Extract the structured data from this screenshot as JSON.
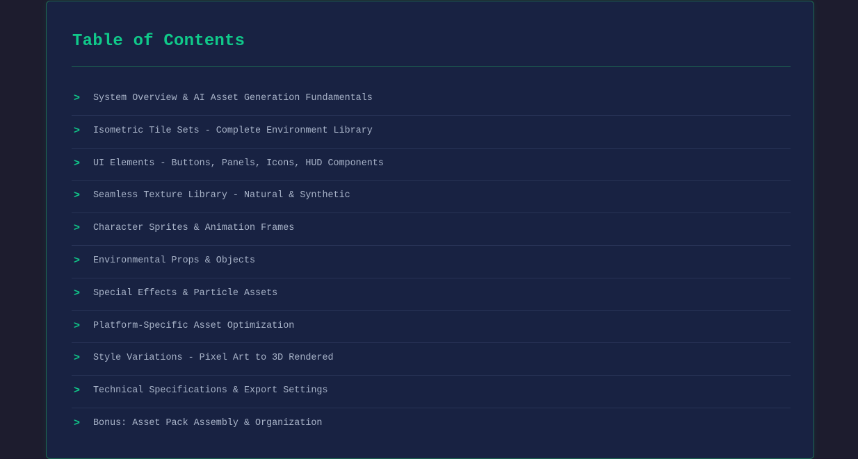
{
  "toc": {
    "title": "Table of Contents",
    "marker": ">",
    "accent_color": "#10c98a",
    "items": [
      {
        "label": "System Overview & AI Asset Generation Fundamentals"
      },
      {
        "label": "Isometric Tile Sets - Complete Environment Library"
      },
      {
        "label": "UI Elements - Buttons, Panels, Icons, HUD Components"
      },
      {
        "label": "Seamless Texture Library - Natural & Synthetic"
      },
      {
        "label": "Character Sprites & Animation Frames"
      },
      {
        "label": "Environmental Props & Objects"
      },
      {
        "label": "Special Effects & Particle Assets"
      },
      {
        "label": "Platform-Specific Asset Optimization"
      },
      {
        "label": "Style Variations - Pixel Art to 3D Rendered"
      },
      {
        "label": "Technical Specifications & Export Settings"
      },
      {
        "label": "Bonus: Asset Pack Assembly & Organization"
      }
    ]
  }
}
